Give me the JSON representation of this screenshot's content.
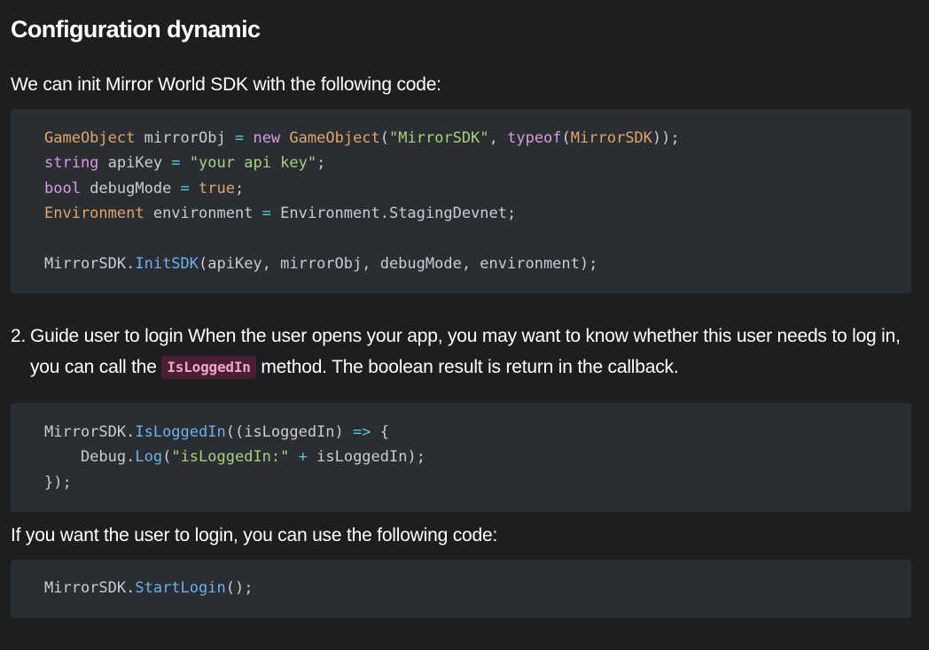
{
  "heading": "Configuration dynamic",
  "intro": "We can init Mirror World SDK with the following code:",
  "code1": {
    "l1": {
      "t1": "GameObject",
      "t2": " mirrorObj ",
      "t3": "=",
      "t4": " ",
      "t5": "new",
      "t6": " ",
      "t7": "GameObject",
      "t8": "(",
      "t9": "\"MirrorSDK\"",
      "t10": ", ",
      "t11": "typeof",
      "t12": "(",
      "t13": "MirrorSDK",
      "t14": "));"
    },
    "l2": {
      "t1": "string",
      "t2": " apiKey ",
      "t3": "=",
      "t4": " ",
      "t5": "\"your api key\"",
      "t6": ";"
    },
    "l3": {
      "t1": "bool",
      "t2": " debugMode ",
      "t3": "=",
      "t4": " ",
      "t5": "true",
      "t6": ";"
    },
    "l4": {
      "t1": "Environment",
      "t2": " environment ",
      "t3": "=",
      "t4": " Environment.StagingDevnet;"
    },
    "l6": {
      "t1": "MirrorSDK.",
      "t2": "InitSDK",
      "t3": "(apiKey, mirrorObj, debugMode, environment);"
    }
  },
  "list_item": {
    "number": "2.",
    "text_before": "Guide user to login When the user opens your app, you may want to know whether this user needs to log in, you can call the ",
    "inline_code": "IsLoggedIn",
    "text_after": " method. The boolean result is return in the callback."
  },
  "code2": {
    "l1": {
      "t1": "MirrorSDK.",
      "t2": "IsLoggedIn",
      "t3": "((isLoggedIn) ",
      "t4": "=>",
      "t5": " {"
    },
    "l2": {
      "t1": "    Debug.",
      "t2": "Log",
      "t3": "(",
      "t4": "\"isLoggedIn:\"",
      "t5": " ",
      "t6": "+",
      "t7": " isLoggedIn);"
    },
    "l3": {
      "t1": "});"
    }
  },
  "login_intro": "If you want the user to login, you can use the following code:",
  "code3": {
    "l1": {
      "t1": "MirrorSDK.",
      "t2": "StartLogin",
      "t3": "();"
    }
  }
}
